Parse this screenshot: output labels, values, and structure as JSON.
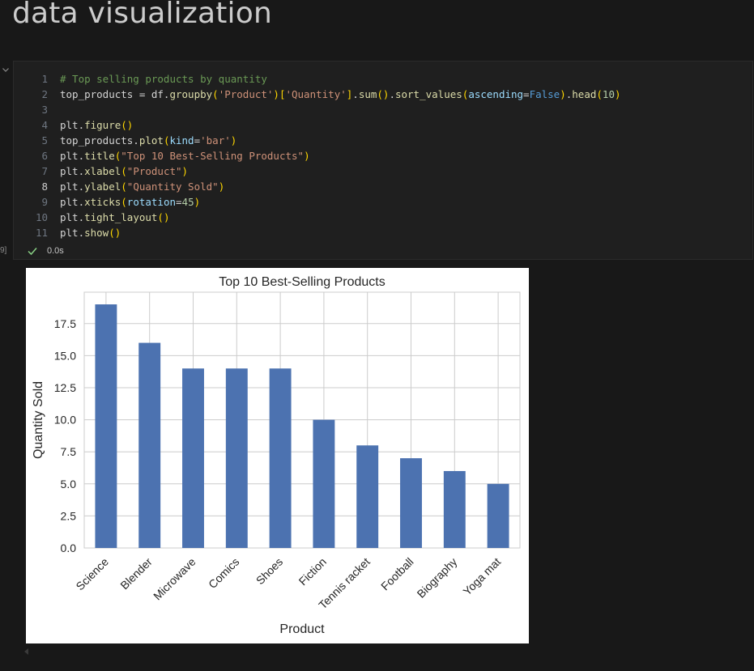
{
  "markdown": {
    "heading": "data visualization"
  },
  "cell": {
    "lines": [
      {
        "n": "1",
        "tokens": [
          {
            "t": "# Top selling products by quantity",
            "c": "cmt"
          }
        ]
      },
      {
        "n": "2",
        "tokens": [
          {
            "t": "top_products = df.",
            "c": ""
          },
          {
            "t": "groupby",
            "c": "fn"
          },
          {
            "t": "(",
            "c": "br1"
          },
          {
            "t": "'Product'",
            "c": "str"
          },
          {
            "t": ")",
            "c": "br1"
          },
          {
            "t": "[",
            "c": "br1"
          },
          {
            "t": "'Quantity'",
            "c": "str"
          },
          {
            "t": "]",
            "c": "br1"
          },
          {
            "t": ".",
            "c": ""
          },
          {
            "t": "sum",
            "c": "fn"
          },
          {
            "t": "()",
            "c": "br1"
          },
          {
            "t": ".",
            "c": ""
          },
          {
            "t": "sort_values",
            "c": "fn"
          },
          {
            "t": "(",
            "c": "br1"
          },
          {
            "t": "ascending",
            "c": "param"
          },
          {
            "t": "=",
            "c": ""
          },
          {
            "t": "False",
            "c": "kw"
          },
          {
            "t": ")",
            "c": "br1"
          },
          {
            "t": ".",
            "c": ""
          },
          {
            "t": "head",
            "c": "fn"
          },
          {
            "t": "(",
            "c": "br1"
          },
          {
            "t": "10",
            "c": "num"
          },
          {
            "t": ")",
            "c": "br1"
          }
        ]
      },
      {
        "n": "3",
        "tokens": []
      },
      {
        "n": "4",
        "tokens": [
          {
            "t": "plt.",
            "c": ""
          },
          {
            "t": "figure",
            "c": "fn"
          },
          {
            "t": "()",
            "c": "br1"
          }
        ]
      },
      {
        "n": "5",
        "tokens": [
          {
            "t": "top_products.",
            "c": ""
          },
          {
            "t": "plot",
            "c": "fn"
          },
          {
            "t": "(",
            "c": "br1"
          },
          {
            "t": "kind",
            "c": "param"
          },
          {
            "t": "=",
            "c": ""
          },
          {
            "t": "'bar'",
            "c": "str"
          },
          {
            "t": ")",
            "c": "br1"
          }
        ]
      },
      {
        "n": "6",
        "tokens": [
          {
            "t": "plt.",
            "c": ""
          },
          {
            "t": "title",
            "c": "fn"
          },
          {
            "t": "(",
            "c": "br1"
          },
          {
            "t": "\"Top 10 Best-Selling Products\"",
            "c": "str"
          },
          {
            "t": ")",
            "c": "br1"
          }
        ]
      },
      {
        "n": "7",
        "tokens": [
          {
            "t": "plt.",
            "c": ""
          },
          {
            "t": "xlabel",
            "c": "fn"
          },
          {
            "t": "(",
            "c": "br1"
          },
          {
            "t": "\"Product\"",
            "c": "str"
          },
          {
            "t": ")",
            "c": "br1"
          }
        ]
      },
      {
        "n": "8",
        "tokens": [
          {
            "t": "plt.",
            "c": ""
          },
          {
            "t": "ylabel",
            "c": "fn"
          },
          {
            "t": "(",
            "c": "br1"
          },
          {
            "t": "\"Quantity Sold\"",
            "c": "str"
          },
          {
            "t": ")",
            "c": "br1"
          }
        ]
      },
      {
        "n": "9",
        "tokens": [
          {
            "t": "plt.",
            "c": ""
          },
          {
            "t": "xticks",
            "c": "fn"
          },
          {
            "t": "(",
            "c": "br1"
          },
          {
            "t": "rotation",
            "c": "param"
          },
          {
            "t": "=",
            "c": ""
          },
          {
            "t": "45",
            "c": "num"
          },
          {
            "t": ")",
            "c": "br1"
          }
        ]
      },
      {
        "n": "10",
        "tokens": [
          {
            "t": "plt.",
            "c": ""
          },
          {
            "t": "tight_layout",
            "c": "fn"
          },
          {
            "t": "()",
            "c": "br1"
          }
        ]
      },
      {
        "n": "11",
        "tokens": [
          {
            "t": "plt.",
            "c": ""
          },
          {
            "t": "show",
            "c": "fn"
          },
          {
            "t": "()",
            "c": "br1"
          }
        ]
      }
    ],
    "active_line": "8",
    "exec_time": "0.0s",
    "exec_count": "9]"
  },
  "colors": {
    "success_check": "#89d185",
    "bar": "#4c72b0"
  },
  "icons": {
    "collapse": "chevron-down-icon",
    "status": "check-icon",
    "scroll": "triangle-left-icon"
  },
  "chart_data": {
    "type": "bar",
    "title": "Top 10 Best-Selling Products",
    "xlabel": "Product",
    "ylabel": "Quantity Sold",
    "categories": [
      "Science",
      "Blender",
      "Microwave",
      "Comics",
      "Shoes",
      "Fiction",
      "Tennis racket",
      "Football",
      "Biography",
      "Yoga mat"
    ],
    "values": [
      19,
      16,
      14,
      14,
      14,
      10,
      8,
      7,
      6,
      5
    ],
    "yticks": [
      "0.0",
      "2.5",
      "5.0",
      "7.5",
      "10.0",
      "12.5",
      "15.0",
      "17.5"
    ],
    "ylim": [
      0,
      19.95
    ],
    "grid": true,
    "x_tick_rotation": 45
  }
}
